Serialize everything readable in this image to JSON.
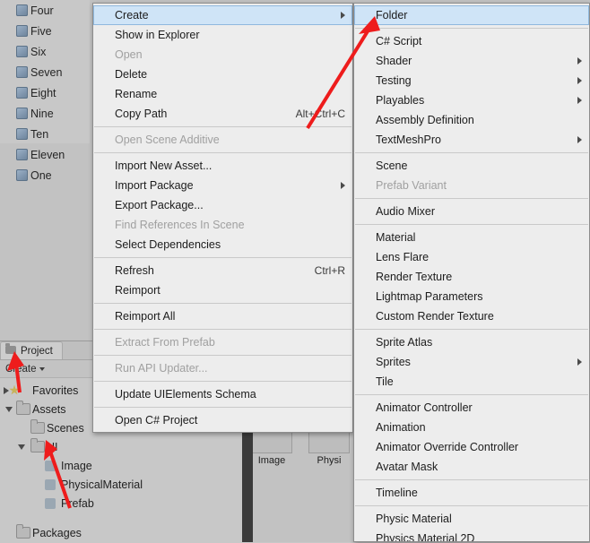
{
  "window": {
    "app": "unity-editor"
  },
  "hierarchy": {
    "items": [
      {
        "label": "Four"
      },
      {
        "label": "Five"
      },
      {
        "label": "Six"
      },
      {
        "label": "Seven"
      },
      {
        "label": "Eight"
      },
      {
        "label": "Nine"
      },
      {
        "label": "Ten"
      },
      {
        "label": "Eleven"
      },
      {
        "label": "One"
      }
    ]
  },
  "project_panel": {
    "tab_label": "Project",
    "create_label": "Create",
    "tree": [
      {
        "label": "Favorites",
        "icon": "star-icon",
        "indent": 0,
        "twisty": "closed"
      },
      {
        "label": "Assets",
        "icon": "folder-icon",
        "indent": 1,
        "twisty": "open"
      },
      {
        "label": "Scenes",
        "icon": "folder-icon",
        "indent": 2,
        "twisty": "none"
      },
      {
        "label": "UI",
        "icon": "folder-icon",
        "indent": 2,
        "twisty": "open"
      },
      {
        "label": "Image",
        "icon": "asset-icon",
        "indent": 3,
        "twisty": "none"
      },
      {
        "label": "PhysicalMaterial",
        "icon": "asset-icon",
        "indent": 3,
        "twisty": "none"
      },
      {
        "label": "Prefab",
        "icon": "asset-icon",
        "indent": 3,
        "twisty": "none"
      },
      {
        "label": "Packages",
        "icon": "folder-icon",
        "indent": 1,
        "twisty": "closed"
      }
    ],
    "assets": [
      {
        "label": "Image"
      },
      {
        "label": "Physi"
      }
    ]
  },
  "context_menu": {
    "items": [
      {
        "label": "Create",
        "shortcut": "",
        "submenu": true,
        "highlight": true,
        "disabled": false
      },
      {
        "label": "Show in Explorer",
        "shortcut": "",
        "submenu": false,
        "highlight": false,
        "disabled": false
      },
      {
        "label": "Open",
        "shortcut": "",
        "submenu": false,
        "highlight": false,
        "disabled": true
      },
      {
        "label": "Delete",
        "shortcut": "",
        "submenu": false,
        "highlight": false,
        "disabled": false
      },
      {
        "label": "Rename",
        "shortcut": "",
        "submenu": false,
        "highlight": false,
        "disabled": false
      },
      {
        "label": "Copy Path",
        "shortcut": "Alt+Ctrl+C",
        "submenu": false,
        "highlight": false,
        "disabled": false
      },
      {
        "separator": true
      },
      {
        "label": "Open Scene Additive",
        "shortcut": "",
        "submenu": false,
        "highlight": false,
        "disabled": true
      },
      {
        "separator": true
      },
      {
        "label": "Import New Asset...",
        "shortcut": "",
        "submenu": false,
        "highlight": false,
        "disabled": false
      },
      {
        "label": "Import Package",
        "shortcut": "",
        "submenu": true,
        "highlight": false,
        "disabled": false
      },
      {
        "label": "Export Package...",
        "shortcut": "",
        "submenu": false,
        "highlight": false,
        "disabled": false
      },
      {
        "label": "Find References In Scene",
        "shortcut": "",
        "submenu": false,
        "highlight": false,
        "disabled": true
      },
      {
        "label": "Select Dependencies",
        "shortcut": "",
        "submenu": false,
        "highlight": false,
        "disabled": false
      },
      {
        "separator": true
      },
      {
        "label": "Refresh",
        "shortcut": "Ctrl+R",
        "submenu": false,
        "highlight": false,
        "disabled": false
      },
      {
        "label": "Reimport",
        "shortcut": "",
        "submenu": false,
        "highlight": false,
        "disabled": false
      },
      {
        "separator": true
      },
      {
        "label": "Reimport All",
        "shortcut": "",
        "submenu": false,
        "highlight": false,
        "disabled": false
      },
      {
        "separator": true
      },
      {
        "label": "Extract From Prefab",
        "shortcut": "",
        "submenu": false,
        "highlight": false,
        "disabled": true
      },
      {
        "separator": true
      },
      {
        "label": "Run API Updater...",
        "shortcut": "",
        "submenu": false,
        "highlight": false,
        "disabled": true
      },
      {
        "separator": true
      },
      {
        "label": "Update UIElements Schema",
        "shortcut": "",
        "submenu": false,
        "highlight": false,
        "disabled": false
      },
      {
        "separator": true
      },
      {
        "label": "Open C# Project",
        "shortcut": "",
        "submenu": false,
        "highlight": false,
        "disabled": false
      }
    ]
  },
  "create_submenu": {
    "items": [
      {
        "label": "Folder",
        "submenu": false,
        "highlight": true,
        "disabled": false
      },
      {
        "separator": true
      },
      {
        "label": "C# Script",
        "submenu": false,
        "highlight": false,
        "disabled": false
      },
      {
        "label": "Shader",
        "submenu": true,
        "highlight": false,
        "disabled": false
      },
      {
        "label": "Testing",
        "submenu": true,
        "highlight": false,
        "disabled": false
      },
      {
        "label": "Playables",
        "submenu": true,
        "highlight": false,
        "disabled": false
      },
      {
        "label": "Assembly Definition",
        "submenu": false,
        "highlight": false,
        "disabled": false
      },
      {
        "label": "TextMeshPro",
        "submenu": true,
        "highlight": false,
        "disabled": false
      },
      {
        "separator": true
      },
      {
        "label": "Scene",
        "submenu": false,
        "highlight": false,
        "disabled": false
      },
      {
        "label": "Prefab Variant",
        "submenu": false,
        "highlight": false,
        "disabled": true
      },
      {
        "separator": true
      },
      {
        "label": "Audio Mixer",
        "submenu": false,
        "highlight": false,
        "disabled": false
      },
      {
        "separator": true
      },
      {
        "label": "Material",
        "submenu": false,
        "highlight": false,
        "disabled": false
      },
      {
        "label": "Lens Flare",
        "submenu": false,
        "highlight": false,
        "disabled": false
      },
      {
        "label": "Render Texture",
        "submenu": false,
        "highlight": false,
        "disabled": false
      },
      {
        "label": "Lightmap Parameters",
        "submenu": false,
        "highlight": false,
        "disabled": false
      },
      {
        "label": "Custom Render Texture",
        "submenu": false,
        "highlight": false,
        "disabled": false
      },
      {
        "separator": true
      },
      {
        "label": "Sprite Atlas",
        "submenu": false,
        "highlight": false,
        "disabled": false
      },
      {
        "label": "Sprites",
        "submenu": true,
        "highlight": false,
        "disabled": false
      },
      {
        "label": "Tile",
        "submenu": false,
        "highlight": false,
        "disabled": false
      },
      {
        "separator": true
      },
      {
        "label": "Animator Controller",
        "submenu": false,
        "highlight": false,
        "disabled": false
      },
      {
        "label": "Animation",
        "submenu": false,
        "highlight": false,
        "disabled": false
      },
      {
        "label": "Animator Override Controller",
        "submenu": false,
        "highlight": false,
        "disabled": false
      },
      {
        "label": "Avatar Mask",
        "submenu": false,
        "highlight": false,
        "disabled": false
      },
      {
        "separator": true
      },
      {
        "label": "Timeline",
        "submenu": false,
        "highlight": false,
        "disabled": false
      },
      {
        "separator": true
      },
      {
        "label": "Physic Material",
        "submenu": false,
        "highlight": false,
        "disabled": false
      },
      {
        "label": "Physics Material 2D",
        "submenu": false,
        "highlight": false,
        "disabled": false
      }
    ]
  },
  "annotations": {
    "arrow_color": "#ee1c1c",
    "arrows": [
      {
        "name": "arrow-to-folder"
      },
      {
        "name": "arrow-to-project-tab"
      },
      {
        "name": "arrow-to-ui-folder"
      }
    ]
  }
}
